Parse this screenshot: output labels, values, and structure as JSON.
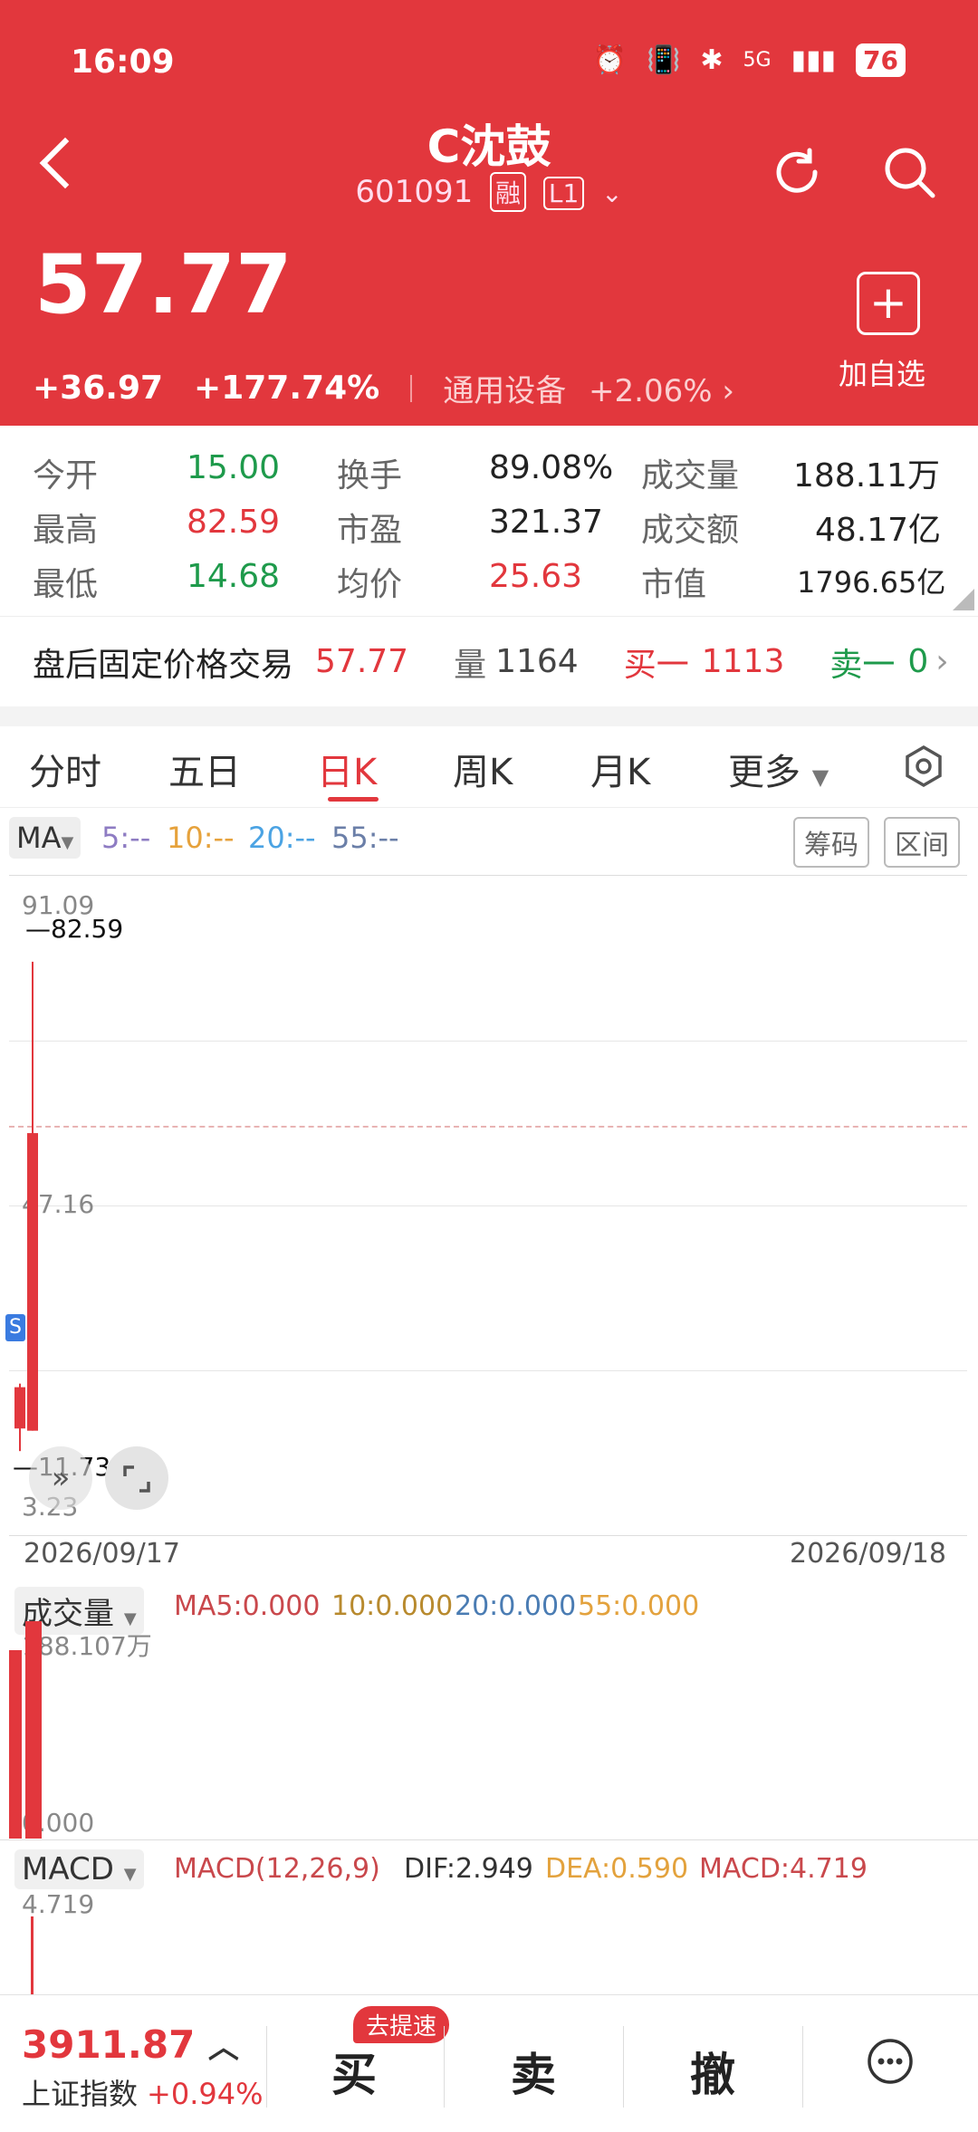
{
  "status": {
    "time": "16:09",
    "signal": "5G",
    "battery": "76"
  },
  "header": {
    "title": "C沈鼓",
    "code": "601091",
    "tag_margin": "融",
    "tag_level": "L1",
    "price": "57.77",
    "change": "+36.97",
    "change_pct": "+177.74%",
    "industry": "通用设备",
    "industry_pct": "+2.06%",
    "add_label": "加自选",
    "add_symbol": "+"
  },
  "stats": {
    "open_label": "今开",
    "open": "15.00",
    "high_label": "最高",
    "high": "82.59",
    "low_label": "最低",
    "low": "14.68",
    "turnover_label": "换手",
    "turnover": "89.08%",
    "pe_label": "市盈",
    "pe": "321.37",
    "avg_label": "均价",
    "avg": "25.63",
    "volume_label": "成交量",
    "volume": "188.11万",
    "amount_label": "成交额",
    "amount": "48.17亿",
    "mcap_label": "市值",
    "mcap": "1796.65亿"
  },
  "postmarket": {
    "label": "盘后固定价格交易",
    "price": "57.77",
    "vol_label": "量",
    "vol": "1164",
    "buy_label": "买一",
    "buy": "1113",
    "sell_label": "卖一",
    "sell": "0"
  },
  "tabs": [
    "分时",
    "五日",
    "日K",
    "周K",
    "月K",
    "更多"
  ],
  "active_tab": "日K",
  "ma": {
    "label": "MA",
    "items": [
      {
        "text": "5:--",
        "color": "#8e7cc3"
      },
      {
        "text": "10:--",
        "color": "#e6a23c"
      },
      {
        "text": "20:--",
        "color": "#4ba3e3"
      },
      {
        "text": "55:--",
        "color": "#6b7fa8"
      }
    ],
    "chip1": "筹码",
    "chip2": "区间"
  },
  "chart": {
    "y_top": "91.09",
    "y_mid": "47.16",
    "y_bottom": "3.23",
    "high_mark": "82.59",
    "low_mark": "11.73",
    "s_marker": "S",
    "date_left": "2026/09/17",
    "date_right": "2026/09/18",
    "candles": [
      {
        "open": 15.0,
        "close": 20.98,
        "high": 21.5,
        "low": 11.73,
        "color": "#e2373d"
      },
      {
        "open": 14.68,
        "close": 57.77,
        "high": 82.59,
        "low": 14.68,
        "color": "#e2373d"
      }
    ]
  },
  "volume": {
    "label": "成交量",
    "ma5": "MA5:0.000",
    "ma10": "10:0.000",
    "ma20": "20:0.000",
    "ma55": "55:0.000",
    "max_label": "188.107万",
    "zero_label": "0.000"
  },
  "macd": {
    "label": "MACD",
    "params": "MACD(12,26,9)",
    "dif": "DIF:2.949",
    "dea": "DEA:0.590",
    "macd": "MACD:4.719",
    "top_label": "4.719"
  },
  "bottom": {
    "index_value": "3911.87",
    "index_name": "上证指数",
    "index_pct": "+0.94%",
    "badge": "去提速",
    "buy": "买",
    "sell": "卖",
    "cancel": "撤"
  }
}
